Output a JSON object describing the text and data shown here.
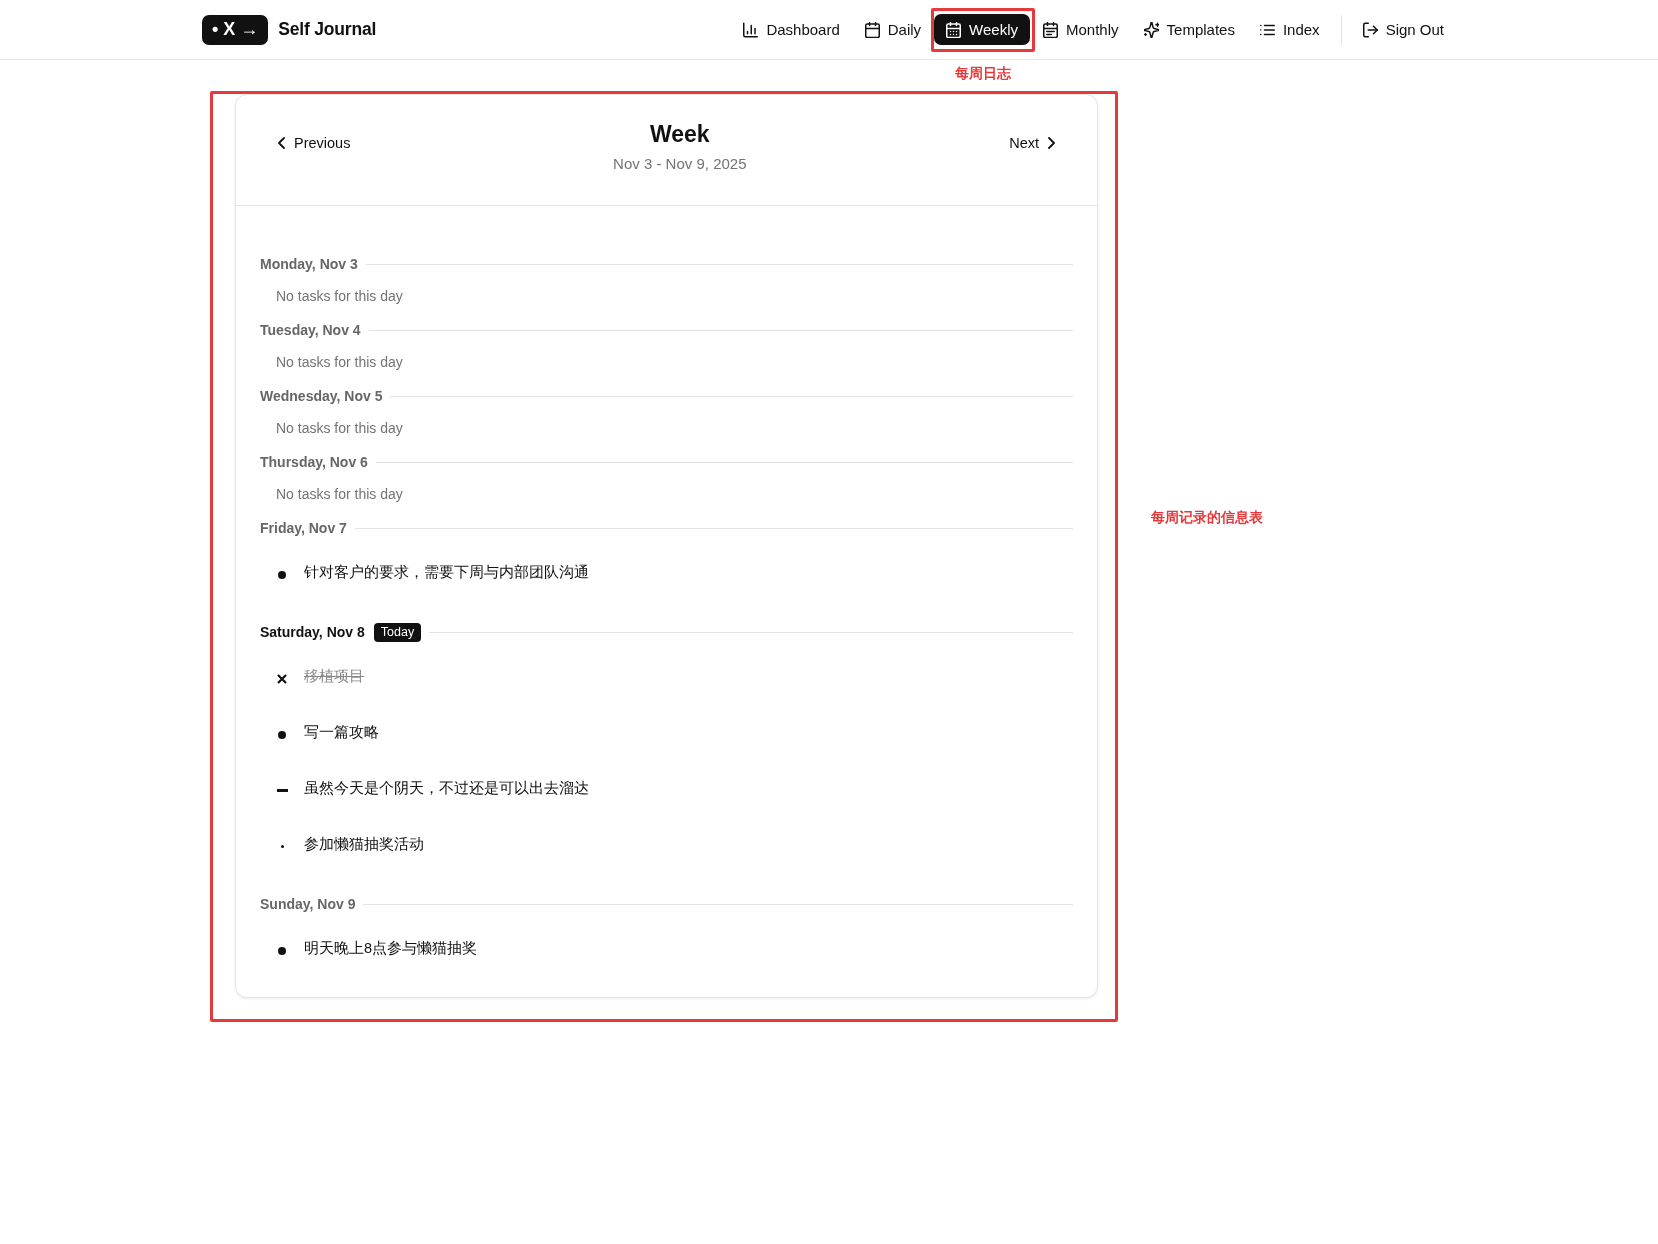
{
  "header": {
    "logo_mark": "• X →",
    "app_name": "Self Journal",
    "nav": [
      {
        "label": "Dashboard",
        "selected": false
      },
      {
        "label": "Daily",
        "selected": false
      },
      {
        "label": "Weekly",
        "selected": true
      },
      {
        "label": "Monthly",
        "selected": false
      },
      {
        "label": "Templates",
        "selected": false
      },
      {
        "label": "Index",
        "selected": false
      }
    ],
    "sign_out": {
      "label": "Sign Out"
    }
  },
  "week": {
    "previous": "Previous",
    "title": "Week",
    "date_range": "Nov 3 - Nov 9, 2025",
    "next": "Next",
    "days": [
      {
        "label": "Monday, Nov 3",
        "today": false,
        "empty_message": "No tasks for this day"
      },
      {
        "label": "Tuesday, Nov 4",
        "today": false,
        "empty_message": "No tasks for this day"
      },
      {
        "label": "Wednesday, Nov 5",
        "today": false,
        "empty_message": "No tasks for this day"
      },
      {
        "label": "Thursday, Nov 6",
        "today": false,
        "empty_message": "No tasks for this day"
      },
      {
        "label": "Friday, Nov 7",
        "today": false,
        "tasks": [
          {
            "kind": "task",
            "text": "针对客户的要求，需要下周与内部团队沟通"
          }
        ]
      },
      {
        "label": "Saturday, Nov 8",
        "today": true,
        "badge": "Today",
        "tasks": [
          {
            "kind": "completed",
            "text": "移植项目"
          },
          {
            "kind": "task",
            "text": "写一篇攻略"
          },
          {
            "kind": "note",
            "text": "虽然今天是个阴天，不过还是可以出去溜达"
          },
          {
            "kind": "event",
            "text": "参加懒猫抽奖活动"
          }
        ]
      },
      {
        "label": "Sunday, Nov 9",
        "today": false,
        "tasks": [
          {
            "kind": "task",
            "text": "明天晚上8点参与懒猫抽奖"
          }
        ]
      }
    ]
  },
  "annotations": [
    {
      "kind": "tab-callout",
      "label": "每周日志"
    },
    {
      "kind": "panel-callout",
      "label": "每周记录的信息表"
    }
  ]
}
